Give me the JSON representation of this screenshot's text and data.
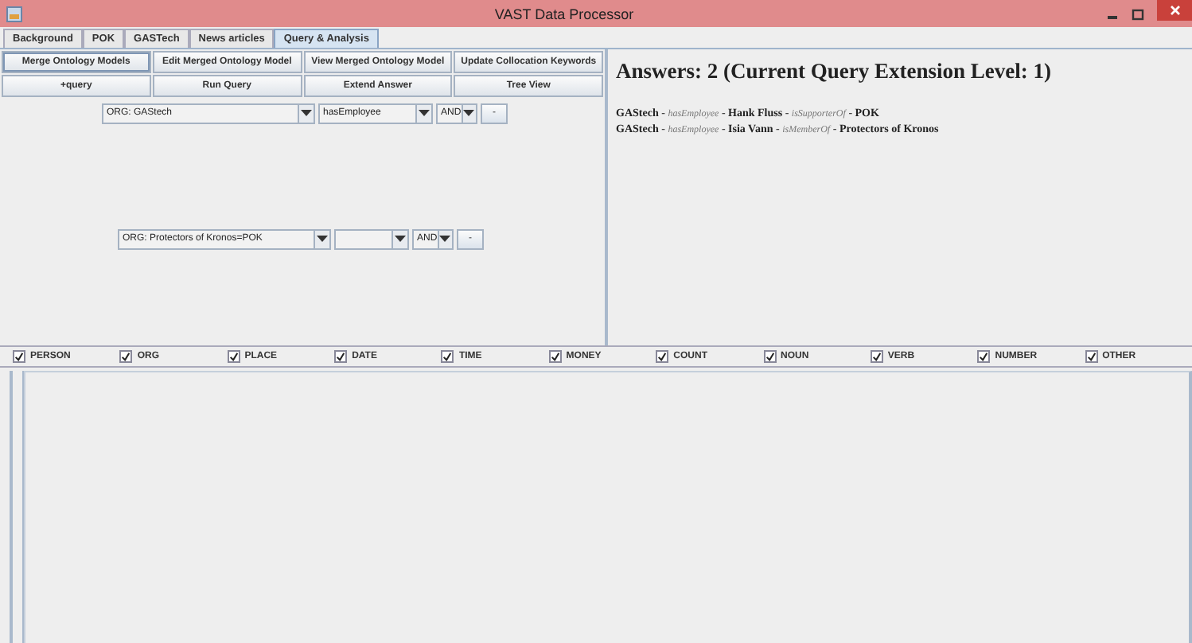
{
  "window": {
    "title": "VAST Data Processor"
  },
  "tabs": [
    {
      "label": "Background",
      "selected": false
    },
    {
      "label": "POK",
      "selected": false
    },
    {
      "label": "GASTech",
      "selected": false
    },
    {
      "label": "News articles",
      "selected": false
    },
    {
      "label": "Query & Analysis",
      "selected": true
    }
  ],
  "toolbar": [
    {
      "label": "Merge Ontology Models",
      "selected": true
    },
    {
      "label": "Edit Merged Ontology Model",
      "selected": false
    },
    {
      "label": "View Merged Ontology Model",
      "selected": false
    },
    {
      "label": "Update Collocation Keywords",
      "selected": false
    },
    {
      "label": "+query",
      "selected": false
    },
    {
      "label": "Run Query",
      "selected": false
    },
    {
      "label": "Extend Answer",
      "selected": false
    },
    {
      "label": "Tree View",
      "selected": false
    }
  ],
  "queries": [
    {
      "entity": "ORG: GAStech",
      "relation": "hasEmployee",
      "operator": "AND",
      "remove_button": "-"
    },
    {
      "entity": "ORG: Protectors of Kronos=POK",
      "operator": "AND",
      "remove_button": "-"
    }
  ],
  "answers": {
    "heading": "Answers: 2 (Current Query Extension Level: 1)",
    "lines": [
      "**GAStech** - *hasEmployee* - **Hank Fluss** - *isSupporterOf* - **POK**",
      "**GAStech** - *hasEmployee* - **Isia Vann** - *isMemberOf* - **Protectors of Kronos**"
    ]
  },
  "filters": [
    {
      "label": "PERSON",
      "checked": true
    },
    {
      "label": "ORG",
      "checked": true
    },
    {
      "label": "PLACE",
      "checked": true
    },
    {
      "label": "DATE",
      "checked": true
    },
    {
      "label": "TIME",
      "checked": true
    },
    {
      "label": "MONEY",
      "checked": true
    },
    {
      "label": "COUNT",
      "checked": true
    },
    {
      "label": "NOUN",
      "checked": true
    },
    {
      "label": "VERB",
      "checked": true
    },
    {
      "label": "NUMBER",
      "checked": true
    },
    {
      "label": "OTHER",
      "checked": true
    }
  ]
}
